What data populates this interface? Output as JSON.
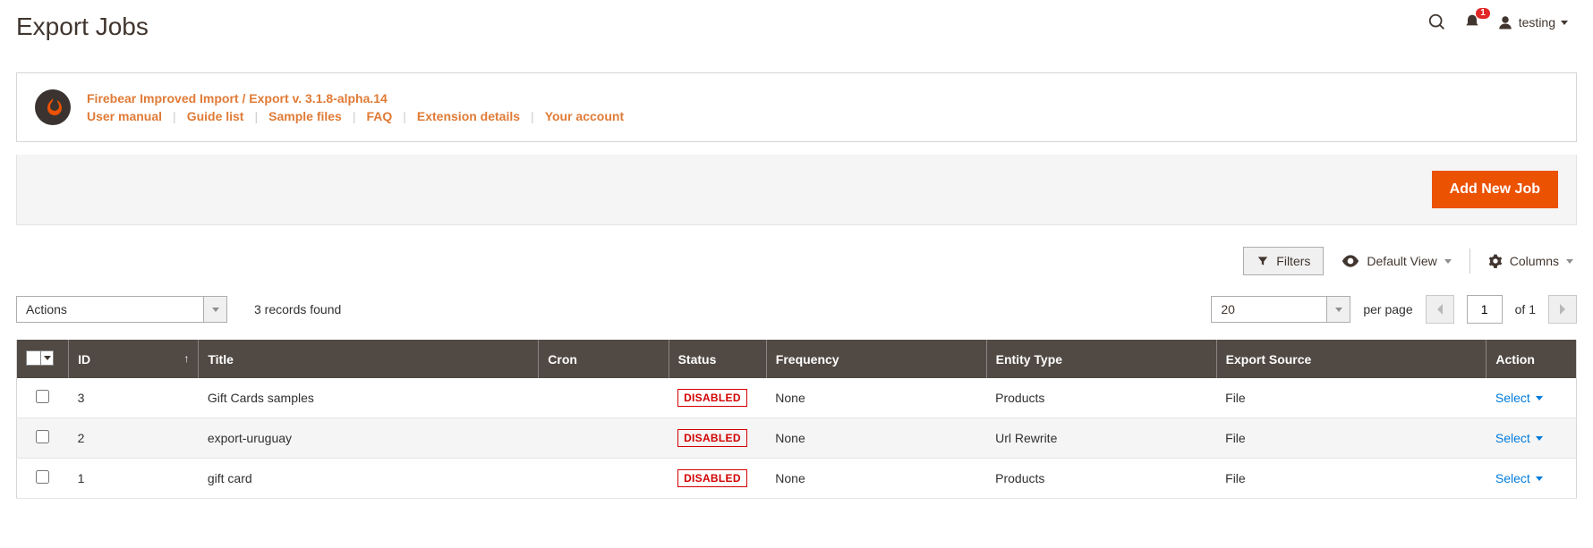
{
  "header": {
    "title": "Export Jobs",
    "notification_count": "1",
    "username": "testing"
  },
  "banner": {
    "title": "Firebear Improved Import / Export v. 3.1.8-alpha.14",
    "links": [
      "User manual",
      "Guide list",
      "Sample files",
      "FAQ",
      "Extension details",
      "Your account"
    ]
  },
  "toolbar": {
    "add_new_label": "Add New Job"
  },
  "grid_controls": {
    "filters_label": "Filters",
    "default_view_label": "Default View",
    "columns_label": "Columns",
    "actions_label": "Actions",
    "records_found": "3 records found",
    "per_page_value": "20",
    "per_page_label": "per page",
    "page_current": "1",
    "page_of": "of 1"
  },
  "columns": {
    "id": "ID",
    "title": "Title",
    "cron": "Cron",
    "status": "Status",
    "frequency": "Frequency",
    "entity_type": "Entity Type",
    "export_source": "Export Source",
    "action": "Action"
  },
  "rows": [
    {
      "id": "3",
      "title": "Gift Cards samples",
      "cron": "",
      "status": "DISABLED",
      "frequency": "None",
      "entity_type": "Products",
      "export_source": "File",
      "action": "Select"
    },
    {
      "id": "2",
      "title": "export-uruguay",
      "cron": "",
      "status": "DISABLED",
      "frequency": "None",
      "entity_type": "Url Rewrite",
      "export_source": "File",
      "action": "Select"
    },
    {
      "id": "1",
      "title": "gift card",
      "cron": "",
      "status": "DISABLED",
      "frequency": "None",
      "entity_type": "Products",
      "export_source": "File",
      "action": "Select"
    }
  ]
}
